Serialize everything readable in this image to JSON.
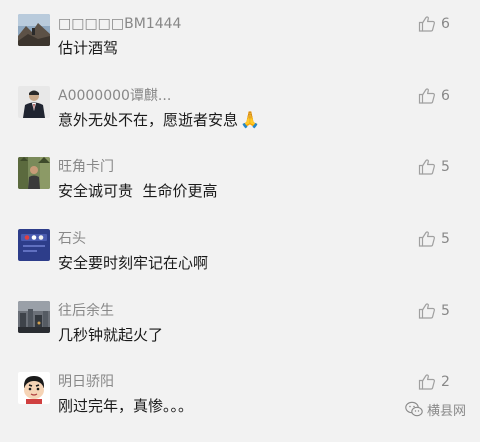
{
  "comments": [
    {
      "user": "□□□□□BM1444",
      "text": "估计酒驾",
      "likes": "6",
      "avatar": "mountain-landscape-avatar"
    },
    {
      "user": "A0000000谭麒...",
      "text": "意外无处不在，愿逝者安息",
      "emoji": "🙏",
      "likes": "6",
      "avatar": "person-in-suit-avatar"
    },
    {
      "user": "旺角卡门",
      "text": "安全诚可贵  生命价更高",
      "likes": "5",
      "avatar": "person-in-trees-avatar"
    },
    {
      "user": "石头",
      "text": "安全要时刻牢记在心啊",
      "likes": "5",
      "avatar": "blue-app-avatar"
    },
    {
      "user": "往后余生",
      "text": "几秒钟就起火了",
      "likes": "5",
      "avatar": "cityscape-avatar"
    },
    {
      "user": "明日骄阳",
      "text": "刚过完年，真惨。。。",
      "likes": "2",
      "avatar": "cartoon-character-avatar"
    }
  ],
  "watermark": {
    "label": "横县网",
    "icon": "wechat-icon"
  },
  "colors": {
    "background": "#f2f2f2",
    "username": "#888888",
    "text": "#1a1a1a",
    "like_icon": "#a0a0a0"
  }
}
